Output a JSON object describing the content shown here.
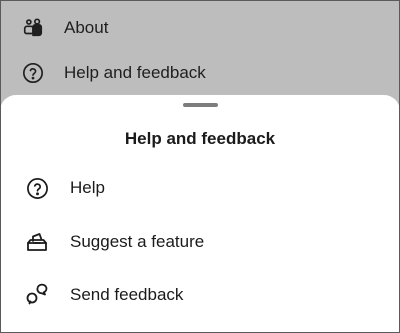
{
  "background_menu": {
    "items": [
      {
        "label": "About",
        "icon": "people-icon"
      },
      {
        "label": "Help and feedback",
        "icon": "question-circle-icon"
      }
    ]
  },
  "sheet": {
    "title": "Help and feedback",
    "items": [
      {
        "label": "Help",
        "icon": "question-circle-icon"
      },
      {
        "label": "Suggest a feature",
        "icon": "suggestion-box-icon"
      },
      {
        "label": "Send feedback",
        "icon": "feedback-bubbles-icon"
      }
    ]
  },
  "colors": {
    "scrim": "#bdbdbd",
    "sheet_background": "#ffffff",
    "text": "#1b1b1b",
    "handle": "#7d7d7d"
  }
}
